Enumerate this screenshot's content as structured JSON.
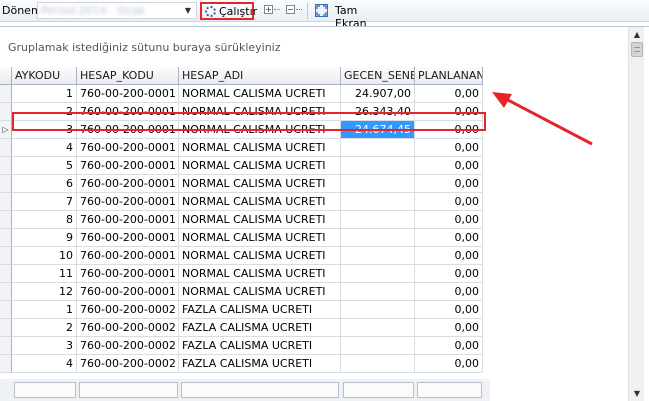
{
  "toolbar": {
    "donem_label": "Dönem",
    "period_value": "Period 2014 · Ocak",
    "run_label": "Çalıştır",
    "fullscreen_label": "Tam Ekran"
  },
  "grid": {
    "group_hint": "Gruplamak istediğiniz sütunu buraya sürükleyiniz",
    "columns": [
      "AYKODU",
      "HESAP_KODU",
      "HESAP_ADI",
      "GECEN_SENE",
      "PLANLANAN"
    ],
    "rows": [
      {
        "aykodu": "1",
        "hesap_kodu": "760-00-200-0001",
        "hesap_adi": "NORMAL CALISMA UCRETI",
        "gecen_sene": "24.907,00",
        "planlanan": "0,00"
      },
      {
        "aykodu": "2",
        "hesap_kodu": "760-00-200-0001",
        "hesap_adi": "NORMAL CALISMA UCRETI",
        "gecen_sene": "26.343,40",
        "planlanan": "0,00"
      },
      {
        "aykodu": "3",
        "hesap_kodu": "760-00-200-0001",
        "hesap_adi": "NORMAL CALISMA UCRETI",
        "gecen_sene": "24.674,45",
        "planlanan": "0,00"
      },
      {
        "aykodu": "4",
        "hesap_kodu": "760-00-200-0001",
        "hesap_adi": "NORMAL CALISMA UCRETI",
        "gecen_sene": "",
        "planlanan": "0,00"
      },
      {
        "aykodu": "5",
        "hesap_kodu": "760-00-200-0001",
        "hesap_adi": "NORMAL CALISMA UCRETI",
        "gecen_sene": "",
        "planlanan": "0,00"
      },
      {
        "aykodu": "6",
        "hesap_kodu": "760-00-200-0001",
        "hesap_adi": "NORMAL CALISMA UCRETI",
        "gecen_sene": "",
        "planlanan": "0,00"
      },
      {
        "aykodu": "7",
        "hesap_kodu": "760-00-200-0001",
        "hesap_adi": "NORMAL CALISMA UCRETI",
        "gecen_sene": "",
        "planlanan": "0,00"
      },
      {
        "aykodu": "8",
        "hesap_kodu": "760-00-200-0001",
        "hesap_adi": "NORMAL CALISMA UCRETI",
        "gecen_sene": "",
        "planlanan": "0,00"
      },
      {
        "aykodu": "9",
        "hesap_kodu": "760-00-200-0001",
        "hesap_adi": "NORMAL CALISMA UCRETI",
        "gecen_sene": "",
        "planlanan": "0,00"
      },
      {
        "aykodu": "10",
        "hesap_kodu": "760-00-200-0001",
        "hesap_adi": "NORMAL CALISMA UCRETI",
        "gecen_sene": "",
        "planlanan": "0,00"
      },
      {
        "aykodu": "11",
        "hesap_kodu": "760-00-200-0001",
        "hesap_adi": "NORMAL CALISMA UCRETI",
        "gecen_sene": "",
        "planlanan": "0,00"
      },
      {
        "aykodu": "12",
        "hesap_kodu": "760-00-200-0001",
        "hesap_adi": "NORMAL CALISMA UCRETI",
        "gecen_sene": "",
        "planlanan": "0,00"
      },
      {
        "aykodu": "1",
        "hesap_kodu": "760-00-200-0002",
        "hesap_adi": "FAZLA CALISMA UCRETI",
        "gecen_sene": "",
        "planlanan": "0,00"
      },
      {
        "aykodu": "2",
        "hesap_kodu": "760-00-200-0002",
        "hesap_adi": "FAZLA CALISMA UCRETI",
        "gecen_sene": "",
        "planlanan": "0,00"
      },
      {
        "aykodu": "3",
        "hesap_kodu": "760-00-200-0002",
        "hesap_adi": "FAZLA CALISMA UCRETI",
        "gecen_sene": "",
        "planlanan": "0,00"
      },
      {
        "aykodu": "4",
        "hesap_kodu": "760-00-200-0002",
        "hesap_adi": "FAZLA CALISMA UCRETI",
        "gecen_sene": "",
        "planlanan": "0,00"
      }
    ]
  },
  "colors": {
    "highlight_border": "#e4262a",
    "selected_cell": "#3399ff"
  }
}
